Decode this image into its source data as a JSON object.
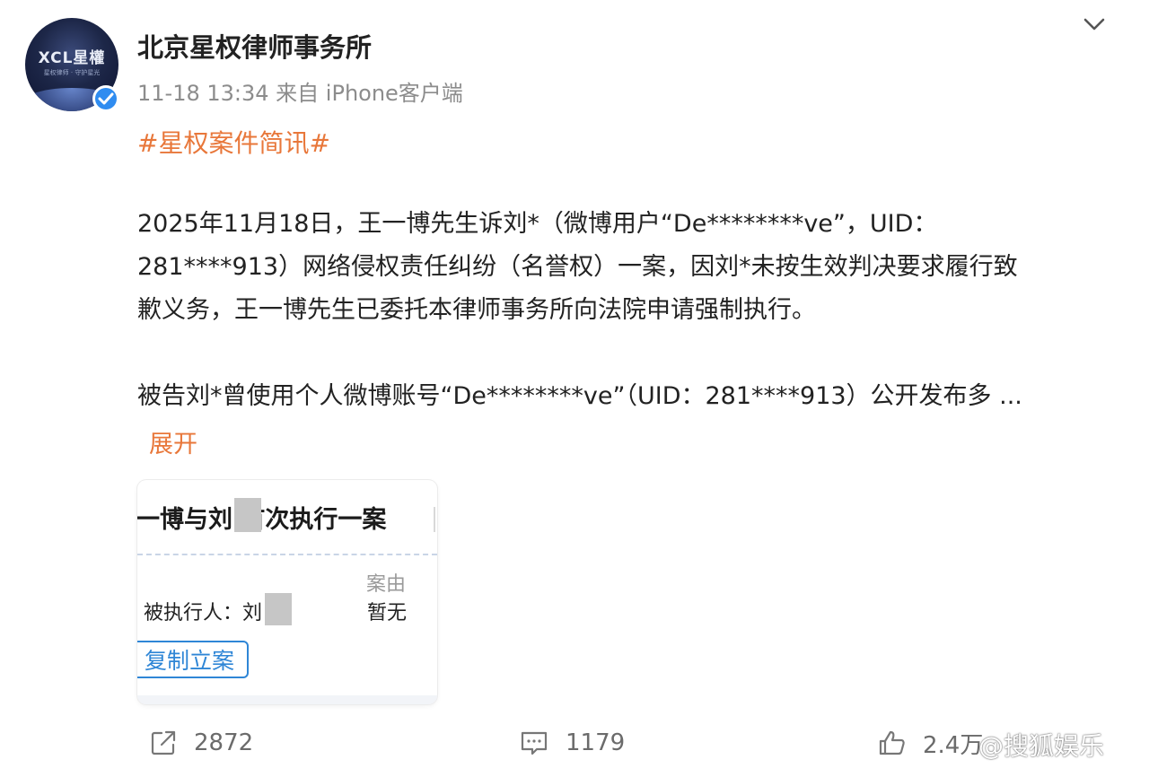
{
  "post": {
    "author_name": "北京星权律师事务所",
    "avatar_logo_text": "XCL星權",
    "avatar_sub_text": "星权律师 · 守护星光",
    "time": "11-18 13:34",
    "source": "来自 iPhone客户端",
    "hashtag": "#星权案件简讯#",
    "paragraph1": [
      "2025年11月18日，王一博先生诉刘*（微博用户“De********ve”，UID：",
      "281****913）网络侵权责任纠纷（名誉权）一案，因刘*未按生效判决要求履行致",
      "歉义务，王一博先生已委托本律师事务所向法院申请强制执行。"
    ],
    "paragraph2": "被告刘*曾使用个人微博账号“De********ve”（UID：281****913）公开发布多  ...",
    "expand_label": "展开"
  },
  "card": {
    "title": "一博与刘   首次执行一案",
    "case_reason_label": "案由",
    "executed_person_label": "被执行人：刘",
    "case_reason_value": "暂无",
    "copy_button_label": "复制立案"
  },
  "actions": {
    "repost_count": "2872",
    "comment_count": "1179",
    "like_count": "2.4万"
  },
  "watermark": "@搜狐娱乐",
  "colors": {
    "accent_orange": "#e8773a",
    "verified_blue": "#2f8cf0",
    "link_blue": "#2f86d6",
    "meta_gray": "#8c8c8c"
  }
}
